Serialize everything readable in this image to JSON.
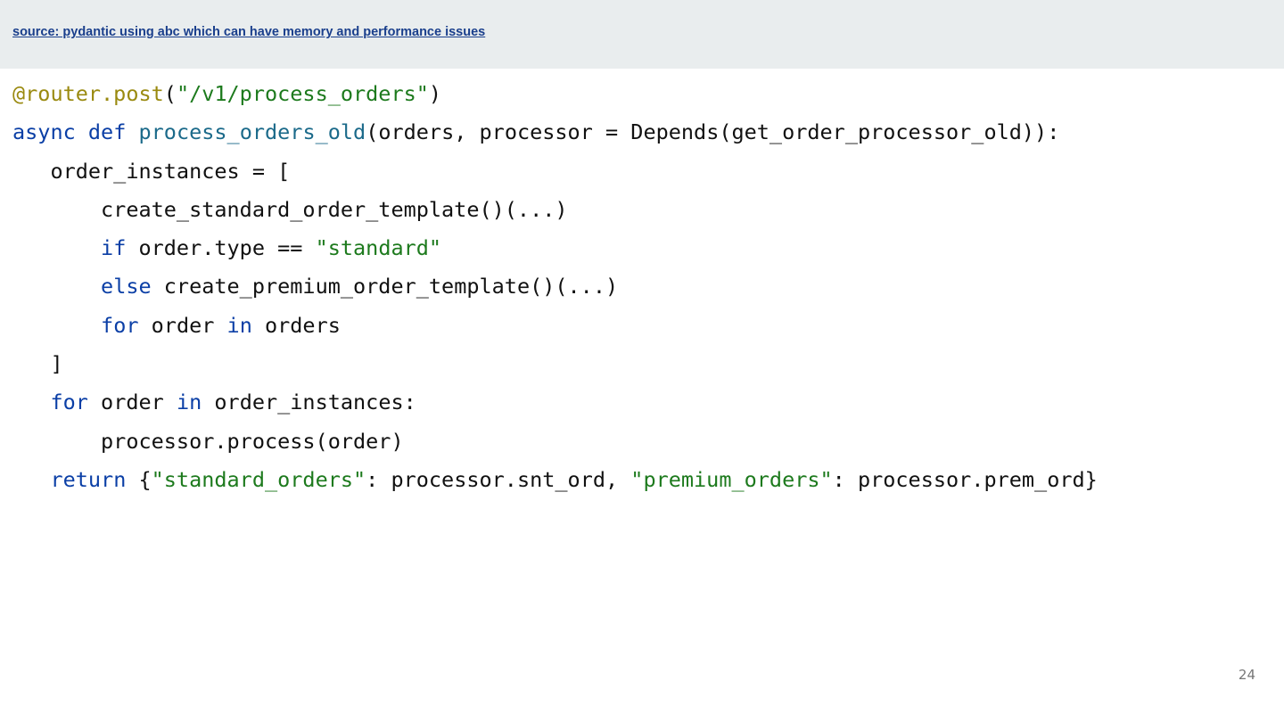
{
  "header": {
    "source_link": "source: pydantic using abc which can have memory and performance issues",
    "background": "#e9edee",
    "link_color": "#1a3f8c"
  },
  "code": {
    "language": "python",
    "colors": {
      "decorator": "#9a8a10",
      "keyword": "#0b3fa6",
      "function": "#1b6a8a",
      "string": "#1d7a1d",
      "plain": "#111111"
    },
    "lines": [
      [
        {
          "t": "@router.post",
          "k": "decorator"
        },
        {
          "t": "(",
          "k": "plain"
        },
        {
          "t": "\"/v1/process_orders\"",
          "k": "string"
        },
        {
          "t": ")",
          "k": "plain"
        }
      ],
      [
        {
          "t": "async",
          "k": "keyword"
        },
        {
          "t": " ",
          "k": "plain"
        },
        {
          "t": "def",
          "k": "keyword"
        },
        {
          "t": " ",
          "k": "plain"
        },
        {
          "t": "process_orders_old",
          "k": "fn"
        },
        {
          "t": "(orders, processor = Depends(get_order_processor_old)):",
          "k": "plain"
        }
      ],
      [
        {
          "t": "   order_instances = [",
          "k": "plain"
        }
      ],
      [
        {
          "t": "       create_standard_order_template()(...)",
          "k": "plain"
        }
      ],
      [
        {
          "t": "       ",
          "k": "plain"
        },
        {
          "t": "if",
          "k": "keyword"
        },
        {
          "t": " order.type == ",
          "k": "plain"
        },
        {
          "t": "\"standard\"",
          "k": "string"
        }
      ],
      [
        {
          "t": "       ",
          "k": "plain"
        },
        {
          "t": "else",
          "k": "keyword"
        },
        {
          "t": " create_premium_order_template()(...)",
          "k": "plain"
        }
      ],
      [
        {
          "t": "       ",
          "k": "plain"
        },
        {
          "t": "for",
          "k": "keyword"
        },
        {
          "t": " order ",
          "k": "plain"
        },
        {
          "t": "in",
          "k": "keyword"
        },
        {
          "t": " orders",
          "k": "plain"
        }
      ],
      [
        {
          "t": "   ]",
          "k": "plain"
        }
      ],
      [
        {
          "t": "   ",
          "k": "plain"
        },
        {
          "t": "for",
          "k": "keyword"
        },
        {
          "t": " order ",
          "k": "plain"
        },
        {
          "t": "in",
          "k": "keyword"
        },
        {
          "t": " order_instances:",
          "k": "plain"
        }
      ],
      [
        {
          "t": "       processor.process(order)",
          "k": "plain"
        }
      ],
      [
        {
          "t": "   ",
          "k": "plain"
        },
        {
          "t": "return",
          "k": "keyword"
        },
        {
          "t": " {",
          "k": "plain"
        },
        {
          "t": "\"standard_orders\"",
          "k": "string"
        },
        {
          "t": ": processor.snt_ord, ",
          "k": "plain"
        },
        {
          "t": "\"premium_orders\"",
          "k": "string"
        },
        {
          "t": ": processor.prem_ord}",
          "k": "plain"
        }
      ]
    ]
  },
  "footer": {
    "page_number": "24"
  }
}
